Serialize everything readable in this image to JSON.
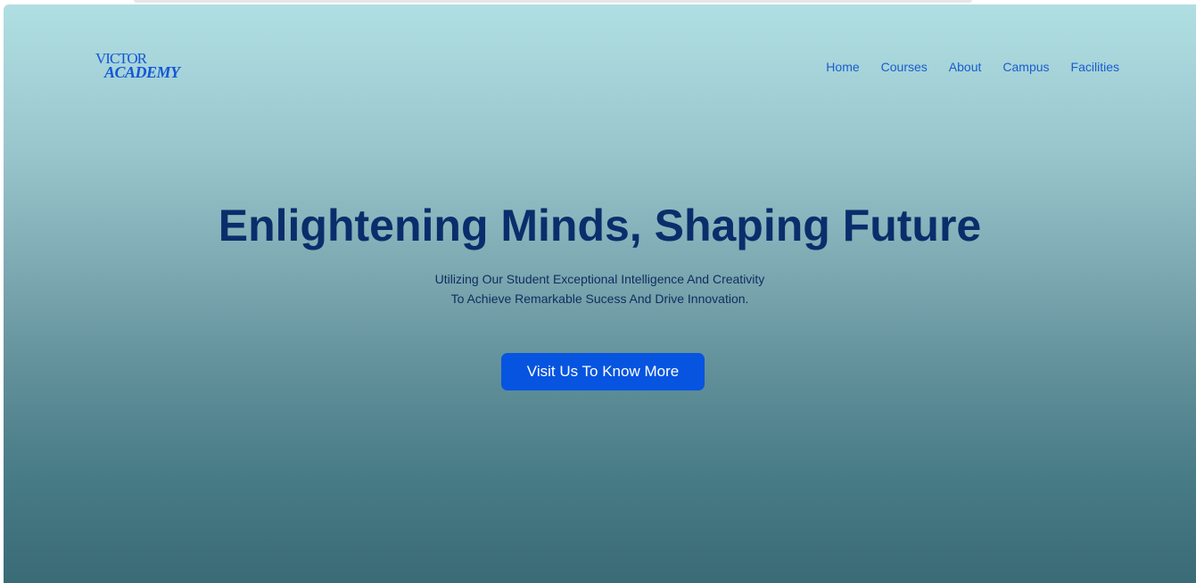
{
  "logo": {
    "line1": "VICTOR",
    "line2": "ACADEMY"
  },
  "nav": {
    "items": [
      {
        "label": "Home"
      },
      {
        "label": "Courses"
      },
      {
        "label": "About"
      },
      {
        "label": "Campus"
      },
      {
        "label": "Facilities"
      }
    ]
  },
  "hero": {
    "title": "Enlightening Minds, Shaping Future",
    "subtitle_line1": "Utilizing Our Student Exceptional Intelligence And Creativity",
    "subtitle_line2": "To Achieve Remarkable Sucess And Drive Innovation.",
    "cta_label": "Visit Us To Know More"
  },
  "colors": {
    "accent": "#0654e0",
    "nav_link": "#1a5ccf",
    "heading": "#0a2e6b",
    "gradient_top": "#b0dfe3",
    "gradient_bottom": "#3a6b77"
  }
}
